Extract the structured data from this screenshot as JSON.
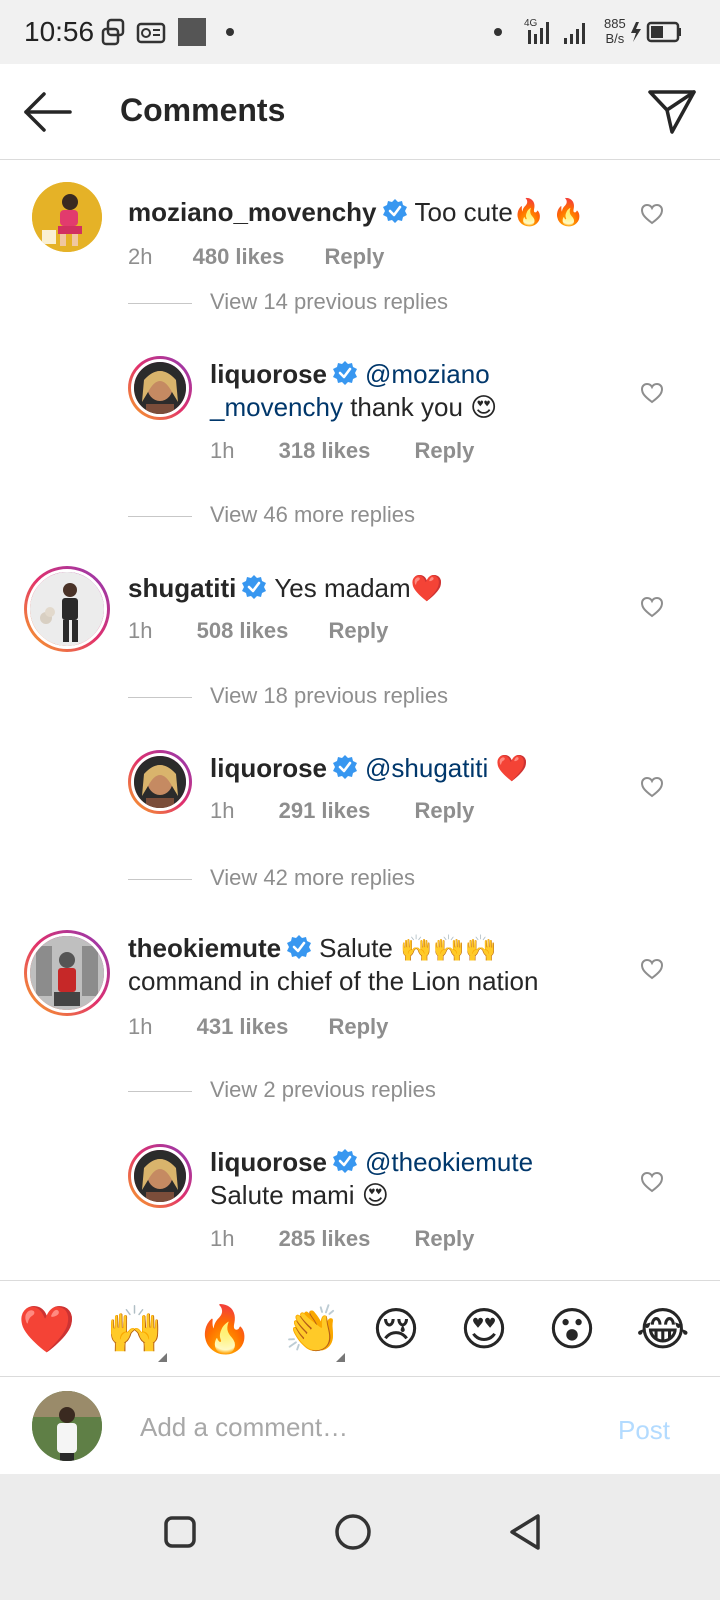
{
  "status_bar": {
    "time": "10:56",
    "net_speed_value": "885",
    "net_speed_unit": "B/s"
  },
  "header": {
    "title": "Comments"
  },
  "comments": [
    {
      "username": "moziano_movenchy",
      "text": "Too cute🔥 🔥",
      "time": "2h",
      "likes": "480 likes",
      "reply": "Reply",
      "avatar_color": "#e5b227"
    },
    {
      "view_replies": "View 14 previous replies"
    },
    {
      "username": "liquorose",
      "mention_part1": "@moziano",
      "mention_part2": "_movenchy",
      "text": " thank you 😍",
      "time": "1h",
      "likes": "318 likes",
      "reply": "Reply"
    },
    {
      "view_replies": "View 46 more replies"
    },
    {
      "username": "shugatiti",
      "text": "Yes madam❤️",
      "time": "1h",
      "likes": "508 likes",
      "reply": "Reply"
    },
    {
      "view_replies": "View 18 previous replies"
    },
    {
      "username": "liquorose",
      "mention": "@shugatiti",
      "text": " ❤️",
      "time": "1h",
      "likes": "291 likes",
      "reply": "Reply"
    },
    {
      "view_replies": "View 42 more replies"
    },
    {
      "username": "theokiemute",
      "text_line1": "Salute 🙌🙌🙌",
      "text_line2": "command in chief of the Lion nation",
      "time": "1h",
      "likes": "431 likes",
      "reply": "Reply"
    },
    {
      "view_replies": "View 2 previous replies"
    },
    {
      "username": "liquorose",
      "mention": "@theokiemute",
      "text_line2": "Salute mami 😍",
      "time": "1h",
      "likes": "285 likes",
      "reply": "Reply"
    }
  ],
  "emoji_bar": [
    "❤️",
    "🙌",
    "🔥",
    "👏",
    "😢",
    "😍",
    "😮",
    "😂"
  ],
  "composer": {
    "placeholder": "Add a comment…",
    "post_label": "Post"
  },
  "colors": {
    "mention": "#00376b",
    "secondary_text": "#8e8e8e",
    "verified_blue": "#3897f0",
    "post_disabled": "#b3dbff"
  }
}
